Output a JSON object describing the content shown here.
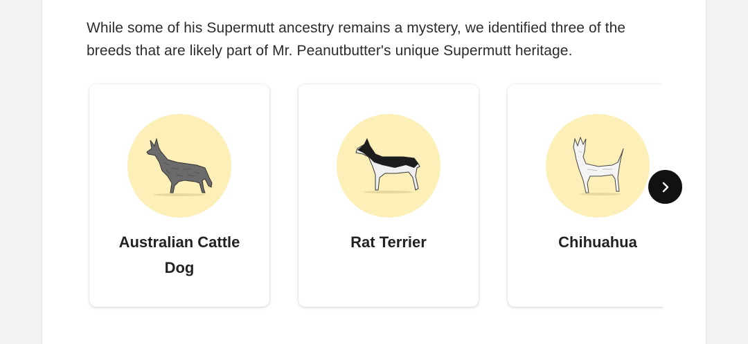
{
  "intro": {
    "text": "While some of his Supermutt ancestry remains a mystery, we identified three of the breeds that are likely part of Mr. Peanutbutter's unique Supermutt heritage."
  },
  "breeds": [
    {
      "name": "Australian Cattle Dog",
      "icon": "australian-cattle-dog-illustration"
    },
    {
      "name": "Rat Terrier",
      "icon": "rat-terrier-illustration"
    },
    {
      "name": "Chihuahua",
      "icon": "chihuahua-illustration"
    }
  ],
  "carousel": {
    "next_icon": "chevron-right-icon"
  },
  "colors": {
    "circle": "#fdefb8",
    "next_button": "#111111",
    "background": "#f2f2f2"
  }
}
